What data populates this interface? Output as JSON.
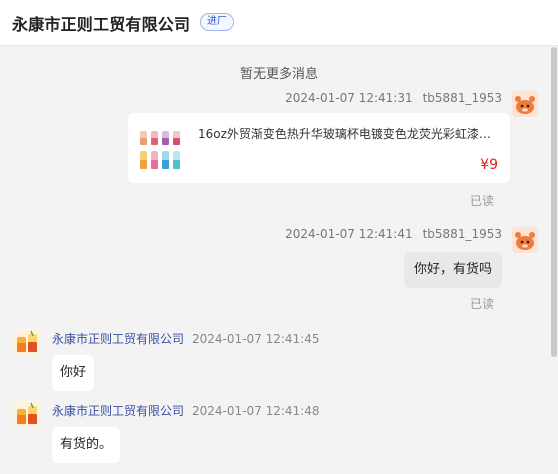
{
  "header": {
    "title": "永康市正则工贸有限公司",
    "badge": "进厂"
  },
  "chat": {
    "no_more": "暂无更多消息",
    "messages": [
      {
        "side": "right",
        "time": "2024-01-07 12:41:31",
        "sender": "tb5881_1953",
        "type": "product",
        "product_title": "16oz外贸渐变色热升华玻璃杯电镀变色龙荧光彩虹漆玻...",
        "price": "¥9",
        "status": "已读"
      },
      {
        "side": "right",
        "time": "2024-01-07 12:41:41",
        "sender": "tb5881_1953",
        "type": "text",
        "text": "你好，有货吗",
        "status": "已读"
      },
      {
        "side": "left",
        "sender": "永康市正则工贸有限公司",
        "time": "2024-01-07 12:41:45",
        "type": "text",
        "text": "你好"
      },
      {
        "side": "left",
        "sender": "永康市正则工贸有限公司",
        "time": "2024-01-07 12:41:48",
        "type": "text",
        "text": "有货的。"
      }
    ]
  },
  "colors": {
    "price": "#e02020",
    "seller_name": "#3b4fa0",
    "badge": "#2f5bd6"
  }
}
